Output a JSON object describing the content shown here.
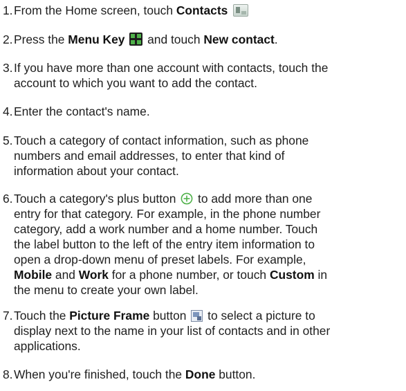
{
  "steps": [
    {
      "num": "1.",
      "a": "From the Home screen, touch ",
      "b": "Contacts"
    },
    {
      "num": "2.",
      "a": "Press the ",
      "b1": "Menu Key",
      "c": " and touch ",
      "b2": "New contact",
      "d": "."
    },
    {
      "num": "3.",
      "line1": "If you have more than one account with contacts, touch the",
      "line2": "account to which you want to add the contact."
    },
    {
      "num": "4.",
      "text": "Enter the contact's name."
    },
    {
      "num": "5.",
      "line1": "Touch a category of contact information, such as phone",
      "line2": "numbers and email addresses, to enter that kind of",
      "line3": "information about your contact."
    },
    {
      "num": "6.",
      "a": "Touch a category's plus button",
      "b": " to add more than one",
      "line2": "entry for that category. For example, in the phone number",
      "line3": "category, add a work number and a home number. Touch",
      "line4": "the label button to the left of the entry item information to",
      "line5": "open a drop-down menu of preset labels. For example,",
      "b1": "Mobile",
      "c": " and ",
      "b2": "Work",
      "d": " for a phone number, or touch ",
      "b3": "Custom",
      "e": " in",
      "line7": "the menu to create your own label."
    },
    {
      "num": "7.",
      "a": "Touch the ",
      "b1": "Picture Frame",
      "c": " button",
      "d": " to select a picture to",
      "line2": "display next to the name in your list of contacts and in other",
      "line3": "applications."
    },
    {
      "num": "8.",
      "a": "When you're finished, touch the ",
      "b": "Done",
      "c": " button."
    }
  ],
  "icons": {
    "contacts": "contacts-app-icon",
    "menu": "menu-key-icon",
    "plus": "plus-circle-icon",
    "frame": "picture-frame-icon",
    "accent_green": "#4fb14a"
  }
}
